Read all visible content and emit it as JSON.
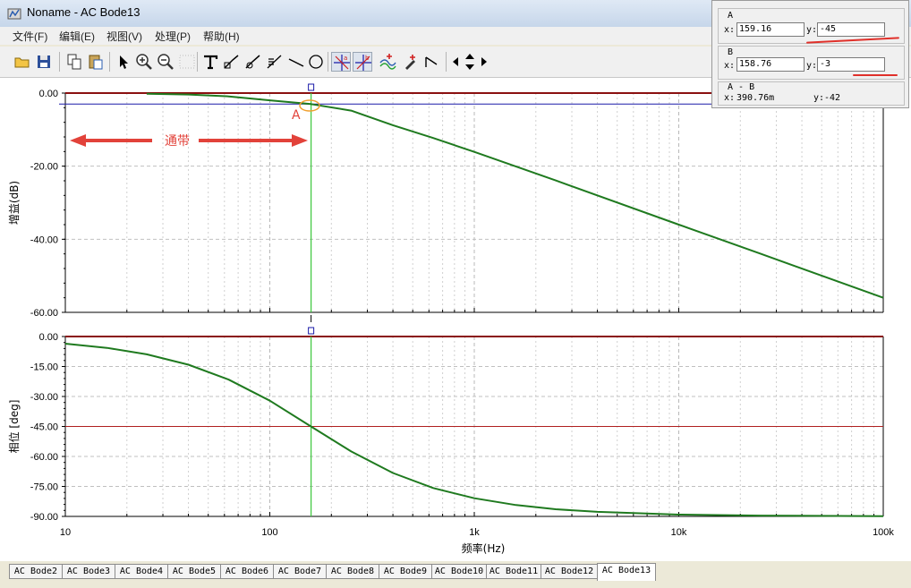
{
  "window": {
    "title": "Noname - AC Bode13"
  },
  "menu": [
    "文件(F)",
    "编辑(E)",
    "视图(V)",
    "处理(P)",
    "帮助(H)"
  ],
  "toolbar": {
    "icons": [
      "open-folder-icon",
      "save-icon",
      "copy-icon",
      "paste-icon",
      "pointer-icon",
      "zoom-in-icon",
      "zoom-out-icon",
      "zoom-100-icon",
      "grid-icon",
      "text-tool-icon",
      "line-tool-icon",
      "annotate-tool-icon",
      "hatch-tool-icon",
      "straight-line-icon",
      "ellipse-icon",
      "cursor-a-icon",
      "cursor-b-icon",
      "add-trace-icon",
      "color-picker-icon",
      "step-icon",
      "scroll-left-icon",
      "scroll-up-down-icon",
      "scroll-right-icon"
    ],
    "pressed": [
      "cursor-a-icon",
      "cursor-b-icon"
    ]
  },
  "cursors": {
    "a": {
      "header": "A",
      "x_label": "x:",
      "x_value": "159.16",
      "y_label": "y:",
      "y_value": "-45"
    },
    "b": {
      "header": "B",
      "x_label": "x:",
      "x_value": "158.76",
      "y_label": "y:",
      "y_value": "-3"
    },
    "diff": {
      "header": "A - B",
      "x_label": "x:",
      "x_value": "390.76m",
      "y_label": "y:",
      "y_value": "-42"
    }
  },
  "annotations": {
    "passband_label": "通带",
    "point_label": "A"
  },
  "chart_data": [
    {
      "type": "line",
      "title": "",
      "xlabel": "频率(Hz)",
      "ylabel": "增益(dB)",
      "xscale": "log",
      "xlim": [
        10,
        100000
      ],
      "ylim": [
        -60,
        0
      ],
      "yticks": [
        "0.00",
        "-20.00",
        "-40.00",
        "-60.00"
      ],
      "cursor_x": 159.16,
      "hline_y": -3,
      "series": [
        {
          "x": [
            25,
            40,
            63,
            100,
            159,
            250,
            400,
            630,
            1000,
            2500,
            10000,
            25000,
            100000
          ],
          "y": [
            -0.16,
            -0.4,
            -0.9,
            -1.99,
            -3.0,
            -4.8,
            -8.8,
            -12.3,
            -16.1,
            -23.9,
            -36.0,
            -43.9,
            -56.0
          ]
        }
      ],
      "colors": {
        "trace": "#1f7a1f",
        "cursor": "#3cc83c",
        "hline": "#1a1aa8",
        "zero_line": "#8a1010"
      }
    },
    {
      "type": "line",
      "title": "",
      "xlabel": "频率(Hz)",
      "ylabel": "相位 [deg]",
      "xscale": "log",
      "xlim": [
        10,
        100000
      ],
      "ylim": [
        -90,
        0
      ],
      "yticks": [
        "0.00",
        "-15.00",
        "-30.00",
        "-45.00",
        "-60.00",
        "-75.00",
        "-90.00"
      ],
      "xticks": [
        "10",
        "100",
        "1k",
        "10k",
        "100k"
      ],
      "cursor_x": 159.16,
      "hline_y": -45,
      "series": [
        {
          "x": [
            10,
            16,
            25,
            40,
            63,
            100,
            159,
            250,
            400,
            630,
            1000,
            1600,
            2500,
            4000,
            10000,
            25000,
            100000
          ],
          "y": [
            -3.6,
            -5.7,
            -8.9,
            -14.1,
            -21.6,
            -32.1,
            -45.0,
            -57.5,
            -68.3,
            -75.8,
            -80.9,
            -84.3,
            -86.4,
            -87.7,
            -89.1,
            -89.6,
            -89.9
          ]
        }
      ],
      "colors": {
        "trace": "#1f7a1f",
        "cursor": "#3cc83c",
        "hline": "#b02020",
        "zero_line": "#8a1010"
      }
    }
  ],
  "tabs": [
    "AC Bode2",
    "AC Bode3",
    "AC Bode4",
    "AC Bode5",
    "AC Bode6",
    "AC Bode7",
    "AC Bode8",
    "AC Bode9",
    "AC Bode10",
    "AC Bode11",
    "AC Bode12",
    "AC Bode13"
  ],
  "active_tab": "AC Bode13"
}
